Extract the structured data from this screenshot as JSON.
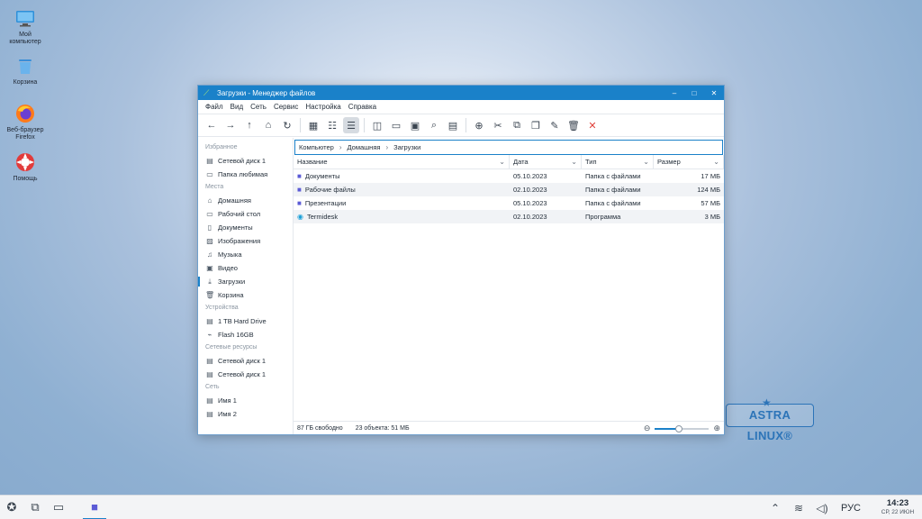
{
  "desktop": {
    "icons": [
      {
        "label": "Мой компьютер"
      },
      {
        "label": "Корзина"
      },
      {
        "label": "Веб-браузер Firefox"
      },
      {
        "label": "Помощь"
      }
    ],
    "brand": "ASTRA LINUX®"
  },
  "window": {
    "title": "Загрузки - Менеджер файлов",
    "controls": {
      "minimize": "–",
      "maximize": "□",
      "close": "✕"
    },
    "menu": [
      "Файл",
      "Вид",
      "Сеть",
      "Сервис",
      "Настройка",
      "Справка"
    ],
    "toolbar": {
      "back": "back-icon",
      "forward": "forward-icon",
      "up": "up-icon",
      "home": "home-icon",
      "reload": "reload-icon"
    },
    "sidebar": {
      "sections": [
        {
          "title": "Избранное",
          "items": [
            "Сетевой диск 1",
            "Папка любимая"
          ]
        },
        {
          "title": "Места",
          "items": [
            "Домашняя",
            "Рабочий стол",
            "Документы",
            "Изображения",
            "Музыка",
            "Видео",
            "Загрузки",
            "Корзина"
          ]
        },
        {
          "title": "Устройства",
          "items": [
            "1 TB Hard Drive",
            "Flash 16GB"
          ]
        },
        {
          "title": "Сетевые ресурсы",
          "items": [
            "Сетевой диск 1",
            "Сетевой диск 1"
          ]
        },
        {
          "title": "Сеть",
          "items": [
            "Имя 1",
            "Имя 2"
          ]
        }
      ],
      "active": "Загрузки"
    },
    "breadcrumb": [
      "Компьютер",
      "Домашняя",
      "Загрузки"
    ],
    "columns": [
      "Название",
      "Дата",
      "Тип",
      "Размер"
    ],
    "files": [
      {
        "name": "Документы",
        "date": "05.10.2023",
        "type": "Папка с файлами",
        "size": "17 МБ",
        "kind": "folder"
      },
      {
        "name": "Рабочие файлы",
        "date": "02.10.2023",
        "type": "Папка с файлами",
        "size": "124 МБ",
        "kind": "folder"
      },
      {
        "name": "Презентации",
        "date": "05.10.2023",
        "type": "Папка с файлами",
        "size": "57 МБ",
        "kind": "folder"
      },
      {
        "name": "Termidesk",
        "date": "02.10.2023",
        "type": "Программа",
        "size": "3 МБ",
        "kind": "program"
      }
    ],
    "status": {
      "free": "87 ГБ свободно",
      "count": "23 объекта: 51 МБ",
      "zoom_level": 0.45
    }
  },
  "taskbar": {
    "lang": "РУС",
    "time": "14:23",
    "date": "СР, 22 ИЮН"
  },
  "colors": {
    "accent": "#1a81c9",
    "folder": "#5b5bd6",
    "close": "#e0413a"
  }
}
